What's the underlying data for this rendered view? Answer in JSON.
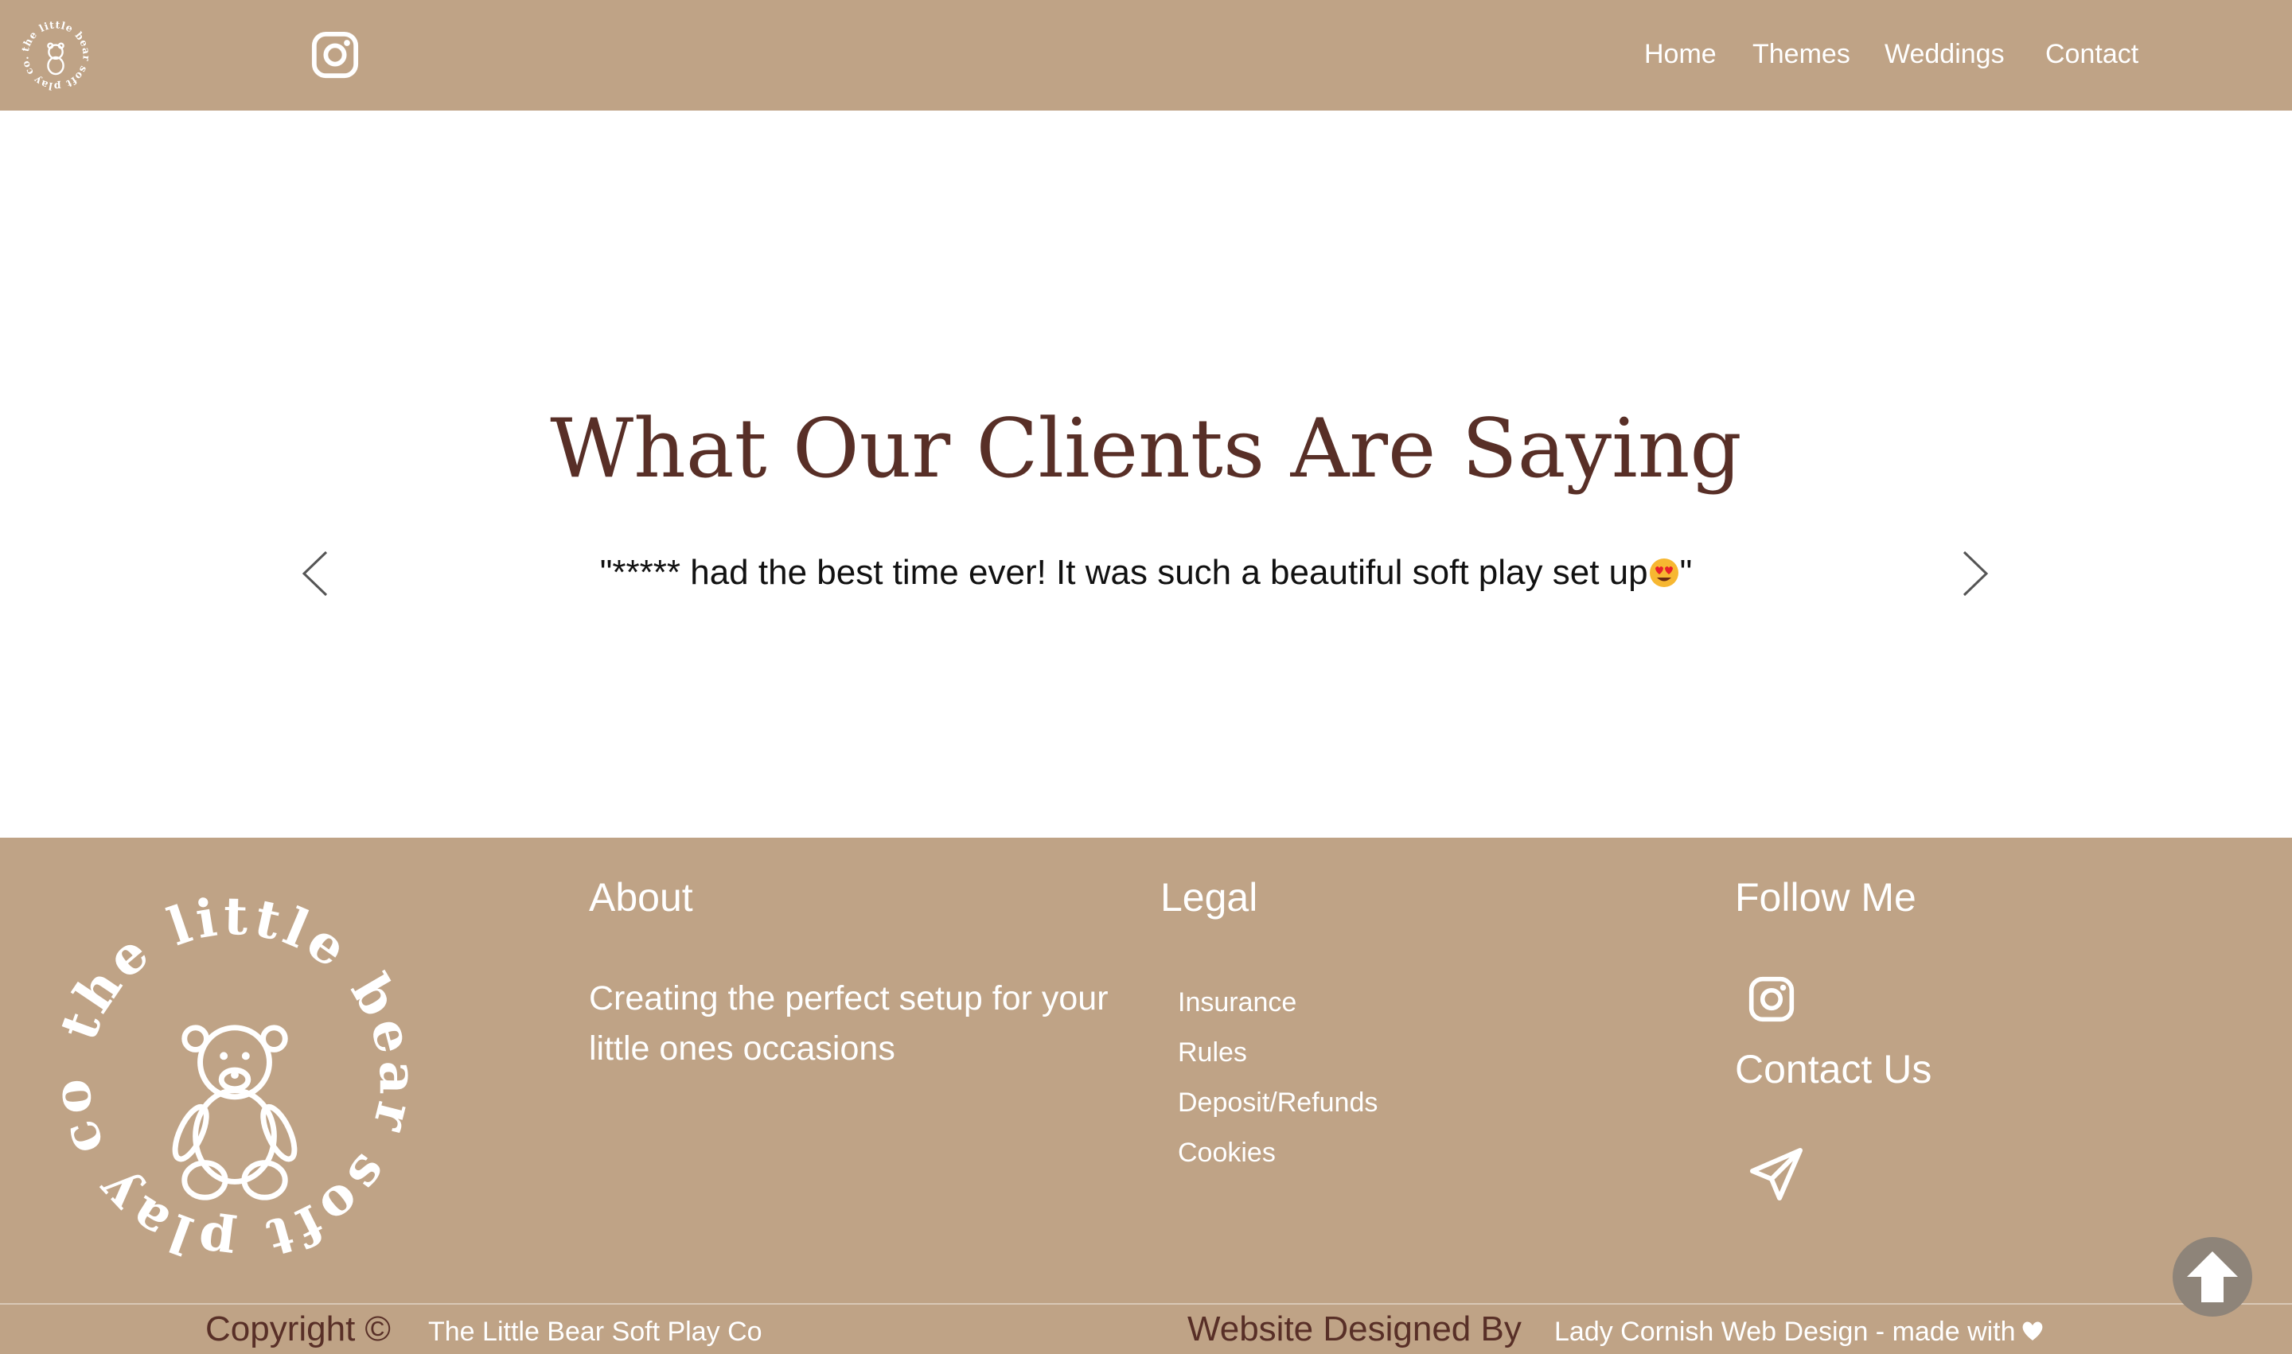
{
  "colors": {
    "brand_tan": "#bfa386",
    "heading_brown": "#582f27",
    "white": "#ffffff",
    "scroll_button": "#8e8479"
  },
  "header": {
    "logo_text": "the little bear soft play co.",
    "instagram_icon": "instagram-icon",
    "nav": [
      "Home",
      "Themes",
      "Weddings",
      "Contact"
    ]
  },
  "testimonial": {
    "title": "What Our Clients Are Saying",
    "quote": "\"***** had the best time ever! It was such a beautiful soft play set up",
    "quote_end": "\"",
    "emoji": "heart-eyes-emoji",
    "prev_icon": "chevron-left-icon",
    "next_icon": "chevron-right-icon"
  },
  "footer": {
    "logo_text": "the little bear soft play co.",
    "about": {
      "heading": "About",
      "text": "Creating the perfect setup for your little ones occasions"
    },
    "legal": {
      "heading": "Legal",
      "links": [
        "Insurance",
        "Rules",
        "Deposit/Refunds",
        "Cookies"
      ]
    },
    "follow": {
      "heading": "Follow Me",
      "icon": "instagram-icon"
    },
    "contact": {
      "heading": "Contact Us",
      "icon": "send-icon"
    },
    "bottom": {
      "copyright_label": "Copyright ©",
      "company": "The Little Bear Soft Play Co",
      "designed_label": "Website Designed By",
      "designer": "Lady Cornish Web Design - made with"
    },
    "scroll_top_icon": "arrow-up-icon"
  }
}
